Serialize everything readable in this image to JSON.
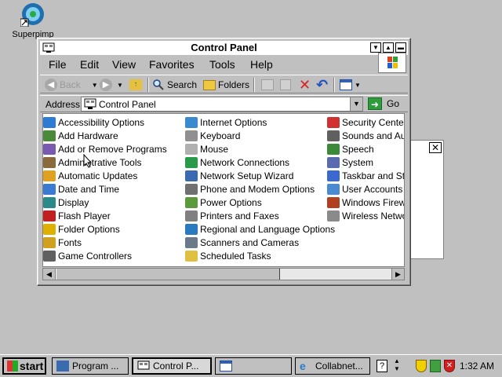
{
  "desktop": {
    "icon_label": "Superpimp"
  },
  "window": {
    "title": "Control Panel",
    "menu": [
      "File",
      "Edit",
      "View",
      "Favorites",
      "Tools",
      "Help"
    ],
    "toolbar": {
      "back": "Back",
      "search": "Search",
      "folders": "Folders"
    },
    "address": {
      "label": "Address",
      "value": "Control Panel",
      "go": "Go"
    },
    "columns": [
      [
        "Accessibility Options",
        "Add Hardware",
        "Add or Remove Programs",
        "Administrative Tools",
        "Automatic Updates",
        "Date and Time",
        "Display",
        "Flash Player",
        "Folder Options",
        "Fonts",
        "Game Controllers"
      ],
      [
        "Internet Options",
        "Keyboard",
        "Mouse",
        "Network Connections",
        "Network Setup Wizard",
        "Phone and Modem Options",
        "Power Options",
        "Printers and Faxes",
        "Regional and Language Options",
        "Scanners and Cameras",
        "Scheduled Tasks"
      ],
      [
        "Security Center",
        "Sounds and Audio",
        "Speech",
        "System",
        "Taskbar and Start",
        "User Accounts",
        "Windows Firewall",
        "Wireless Network"
      ]
    ]
  },
  "taskbar": {
    "start": "start",
    "tasks": [
      "Program ...",
      "Control P...",
      "",
      "Collabnet..."
    ],
    "clock": "1:32 AM"
  },
  "icons": {
    "colors": [
      "#2e7bd6",
      "#4a8a3a",
      "#7a5ab0",
      "#8a6a3a",
      "#e0a020",
      "#3a7ad0",
      "#2a8a8a",
      "#c02020",
      "#e0b000",
      "#d0a020",
      "#606060"
    ]
  }
}
